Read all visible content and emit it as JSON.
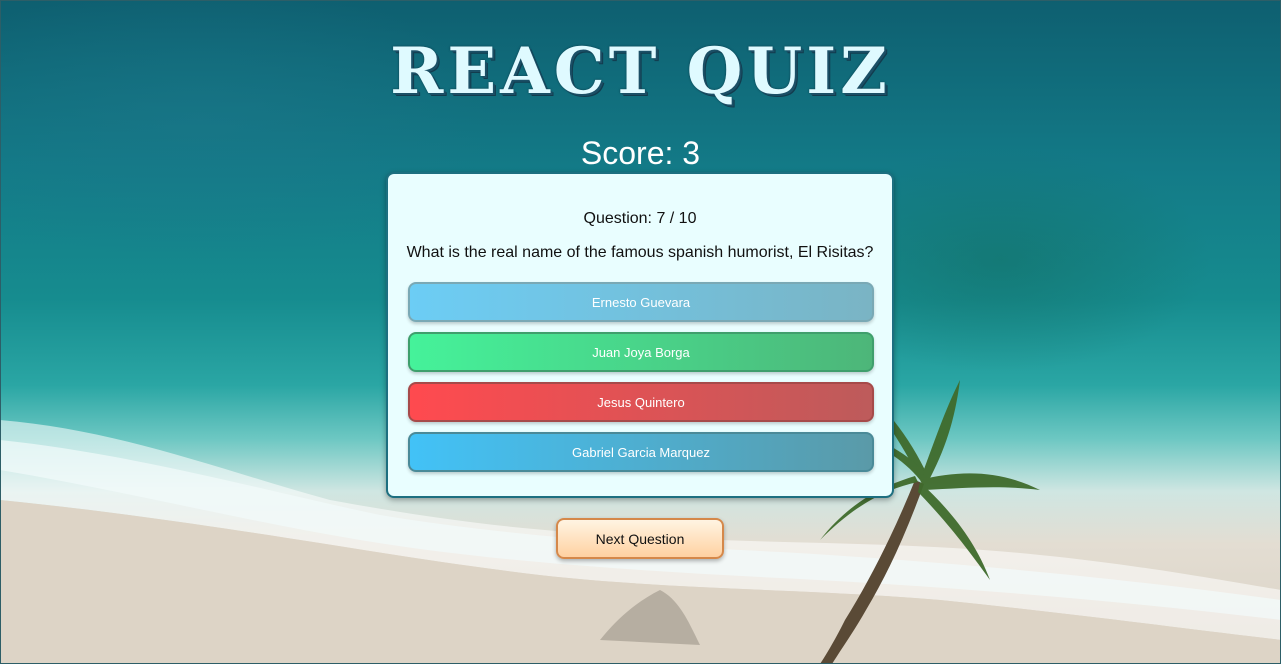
{
  "app": {
    "title": "REACT QUIZ",
    "score_text": "Score: 3"
  },
  "question": {
    "counter": "Question: 7 / 10",
    "text": "What is the real name of the famous spanish humorist, El Risitas?",
    "answers": [
      {
        "label": "Ernesto Guevara",
        "state": "neutral"
      },
      {
        "label": "Juan Joya Borga",
        "state": "correct"
      },
      {
        "label": "Jesus Quintero",
        "state": "wrong"
      },
      {
        "label": "Gabriel Garcia Marquez",
        "state": "neutral"
      }
    ]
  },
  "controls": {
    "next_label": "Next Question"
  },
  "colors": {
    "card_background": "#e9feff",
    "card_border": "#1d6f80",
    "correct": "#45f29a",
    "wrong": "#ff4a4f",
    "neutral": "#6ccdf5",
    "next_button": "#ffd1a1"
  }
}
